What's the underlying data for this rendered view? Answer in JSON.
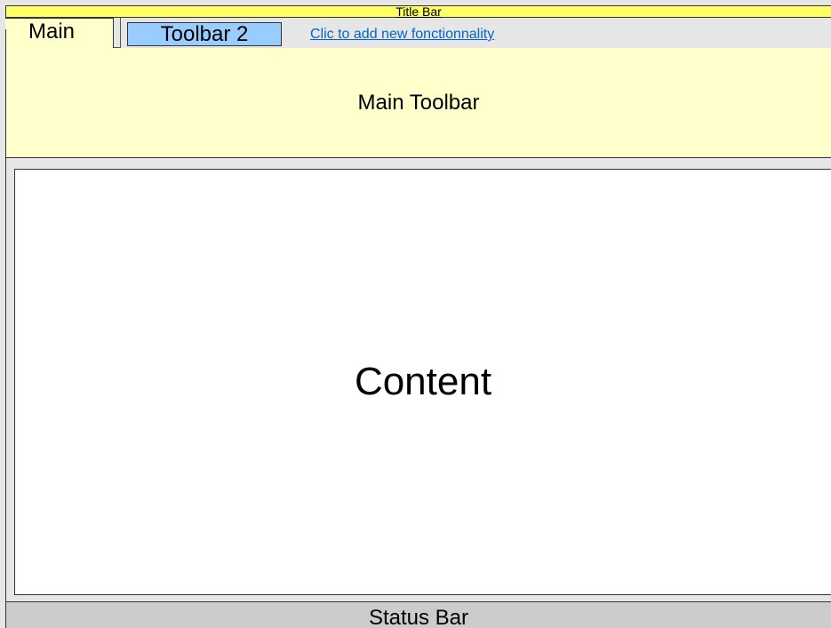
{
  "title_bar": {
    "label": "Title Bar"
  },
  "tabs": [
    {
      "label": "Main",
      "active": true
    },
    {
      "label": "Toolbar 2",
      "active": false
    }
  ],
  "add_link": {
    "label": "Clic to add new fonctionnality"
  },
  "main_toolbar": {
    "label": "Main Toolbar"
  },
  "content": {
    "label": "Content"
  },
  "status_bar": {
    "label": "Status Bar"
  },
  "colors": {
    "title_bar": "#ffff66",
    "active_tab": "#ffffcc",
    "inactive_tab": "#99ccff",
    "link": "#0066cc",
    "status_bar": "#cccccc",
    "chrome": "#e6e6e6"
  }
}
